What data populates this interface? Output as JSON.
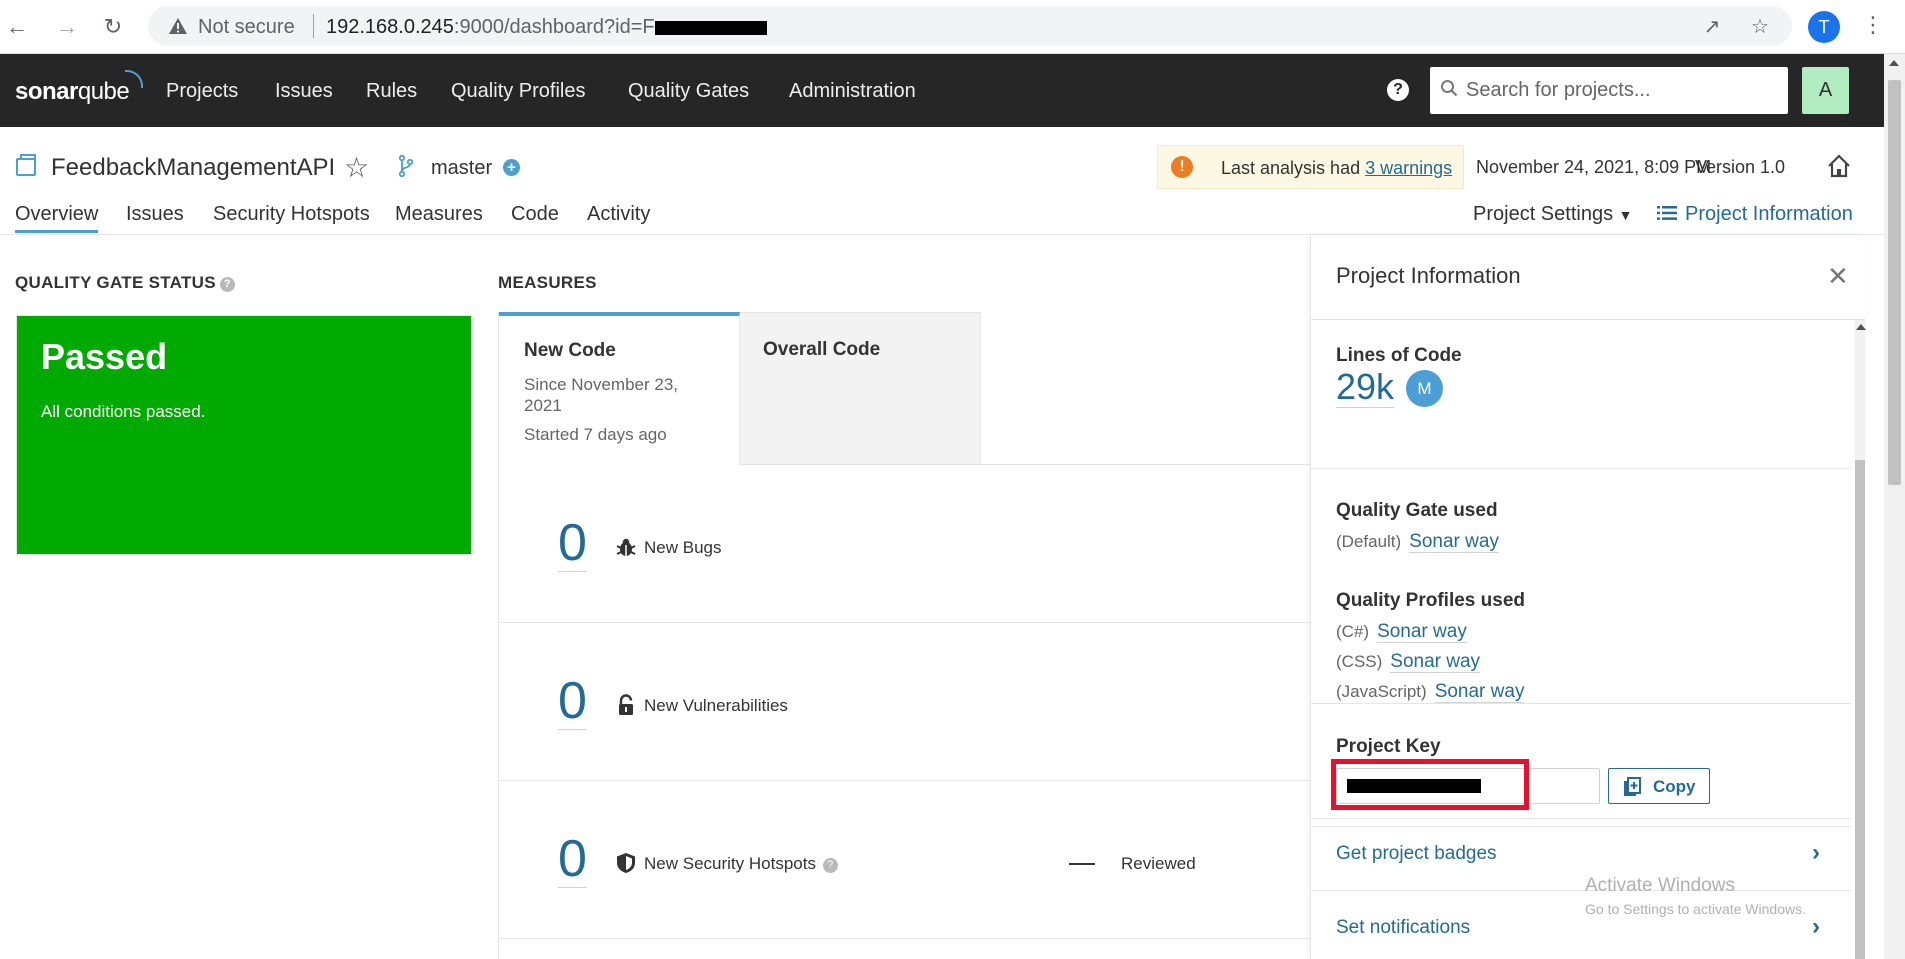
{
  "browser": {
    "not_secure": "Not secure",
    "url_host": "192.168.0.245",
    "url_rest": ":9000/dashboard?id=F",
    "profile_letter": "T"
  },
  "topnav": {
    "logo_bold": "sonar",
    "logo_rest": "qube",
    "links": [
      "Projects",
      "Issues",
      "Rules",
      "Quality Profiles",
      "Quality Gates",
      "Administration"
    ],
    "help": "?",
    "search_placeholder": "Search for projects...",
    "avatar_letter": "A"
  },
  "project": {
    "name": "FeedbackManagementAPI",
    "branch": "master",
    "warning_prefix": "Last analysis had ",
    "warning_link": "3 warnings",
    "analysis_date": "November 24, 2021, 8:09 PM",
    "version": "Version 1.0",
    "tabs": [
      "Overview",
      "Issues",
      "Security Hotspots",
      "Measures",
      "Code",
      "Activity"
    ],
    "settings_label": "Project Settings",
    "info_label": "Project Information"
  },
  "quality_gate": {
    "title": "QUALITY GATE STATUS",
    "status": "Passed",
    "message": "All conditions passed.",
    "color": "#00aa00"
  },
  "measures": {
    "title": "MEASURES",
    "new_code_tab": "New Code",
    "since": "Since November 23, 2021",
    "started": "Started 7 days ago",
    "overall_tab": "Overall Code",
    "rows": [
      {
        "value": "0",
        "label": "New Bugs"
      },
      {
        "value": "0",
        "label": "New Vulnerabilities"
      },
      {
        "value": "0",
        "label": "New Security Hotspots",
        "extra": "Reviewed"
      }
    ]
  },
  "info_panel": {
    "title": "Project Information",
    "loc_title": "Lines of Code",
    "loc_value": "29k",
    "loc_badge": "M",
    "qg_title": "Quality Gate used",
    "qg_default": "(Default)",
    "qg_name": "Sonar way",
    "qp_title": "Quality Profiles used",
    "profiles": [
      {
        "lang": "(C#)",
        "name": "Sonar way"
      },
      {
        "lang": "(CSS)",
        "name": "Sonar way"
      },
      {
        "lang": "(JavaScript)",
        "name": "Sonar way"
      }
    ],
    "key_title": "Project Key",
    "copy_label": "Copy",
    "badges_link": "Get project badges",
    "notif_link": "Set notifications"
  },
  "watermark": {
    "line1": "Activate Windows",
    "line2": "Go to Settings to activate Windows."
  },
  "colors": {
    "topbar": "#262626",
    "accent": "#4b9fd5",
    "link": "#236a97",
    "highlight": "#e8112d"
  }
}
